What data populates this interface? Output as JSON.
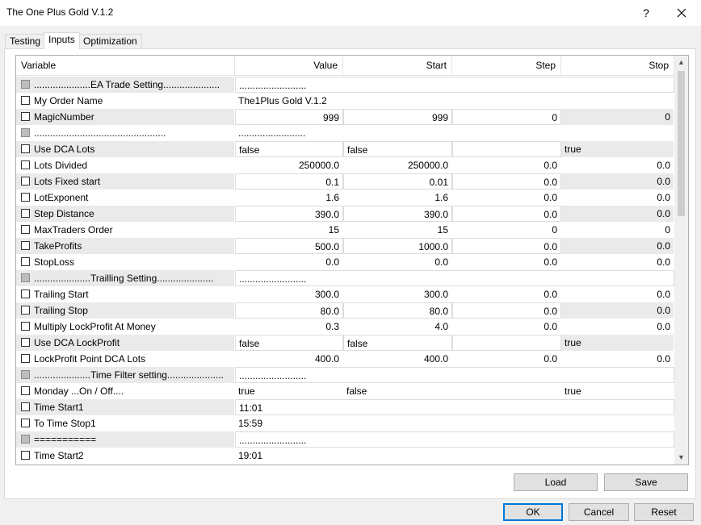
{
  "window": {
    "title": "The One Plus Gold V.1.2",
    "help_label": "?"
  },
  "tabs": [
    "Testing",
    "Inputs",
    "Optimization"
  ],
  "active_tab": "Inputs",
  "columns": {
    "variable": "Variable",
    "value": "Value",
    "start": "Start",
    "step": "Step",
    "stop": "Stop"
  },
  "rows": [
    {
      "name": ".....................EA Trade Setting.....................",
      "value": ".........................",
      "kind": "sep"
    },
    {
      "name": "My Order Name",
      "value": "The1Plus Gold V.1.2",
      "kind": "string"
    },
    {
      "name": "MagicNumber",
      "value": "999",
      "start": "999",
      "step": "0",
      "stop": "0",
      "kind": "num"
    },
    {
      "name": ".................................................",
      "value": ".........................",
      "kind": "sep"
    },
    {
      "name": "Use DCA Lots",
      "value": "false",
      "start": "false",
      "step": "",
      "stop": "true",
      "kind": "bool"
    },
    {
      "name": "Lots Divided",
      "value": "250000.0",
      "start": "250000.0",
      "step": "0.0",
      "stop": "0.0",
      "kind": "num"
    },
    {
      "name": "Lots Fixed start",
      "value": "0.1",
      "start": "0.01",
      "step": "0.0",
      "stop": "0.0",
      "kind": "num"
    },
    {
      "name": "LotExponent",
      "value": "1.6",
      "start": "1.6",
      "step": "0.0",
      "stop": "0.0",
      "kind": "num"
    },
    {
      "name": "Step Distance",
      "value": "390.0",
      "start": "390.0",
      "step": "0.0",
      "stop": "0.0",
      "kind": "num"
    },
    {
      "name": "MaxTraders Order",
      "value": "15",
      "start": "15",
      "step": "0",
      "stop": "0",
      "kind": "num"
    },
    {
      "name": "TakeProfits",
      "value": "500.0",
      "start": "1000.0",
      "step": "0.0",
      "stop": "0.0",
      "kind": "num"
    },
    {
      "name": "StopLoss",
      "value": "0.0",
      "start": "0.0",
      "step": "0.0",
      "stop": "0.0",
      "kind": "num"
    },
    {
      "name": ".....................Trailling Setting.....................",
      "value": ".........................",
      "kind": "sep"
    },
    {
      "name": "Trailing Start",
      "value": "300.0",
      "start": "300.0",
      "step": "0.0",
      "stop": "0.0",
      "kind": "num"
    },
    {
      "name": "Trailing Stop",
      "value": "80.0",
      "start": "80.0",
      "step": "0.0",
      "stop": "0.0",
      "kind": "num"
    },
    {
      "name": "Multiply LockProfit At Money",
      "value": "0.3",
      "start": "4.0",
      "step": "0.0",
      "stop": "0.0",
      "kind": "num"
    },
    {
      "name": "Use DCA LockProfit",
      "value": "false",
      "start": "false",
      "step": "",
      "stop": "true",
      "kind": "bool"
    },
    {
      "name": "LockProfit Point DCA Lots",
      "value": "400.0",
      "start": "400.0",
      "step": "0.0",
      "stop": "0.0",
      "kind": "num"
    },
    {
      "name": ".....................Time Filter setting.....................",
      "value": ".........................",
      "kind": "sep"
    },
    {
      "name": "Monday ...On / Off....",
      "value": "true",
      "start": "false",
      "step": "",
      "stop": "true",
      "kind": "bool"
    },
    {
      "name": "Time Start1",
      "value": "11:01",
      "kind": "string"
    },
    {
      "name": "To Time Stop1",
      "value": "15:59",
      "kind": "string"
    },
    {
      "name": "===========",
      "value": ".........................",
      "kind": "sep"
    },
    {
      "name": "Time Start2",
      "value": "19:01",
      "kind": "string"
    }
  ],
  "buttons": {
    "load": "Load",
    "save": "Save",
    "ok": "OK",
    "cancel": "Cancel",
    "reset": "Reset"
  }
}
